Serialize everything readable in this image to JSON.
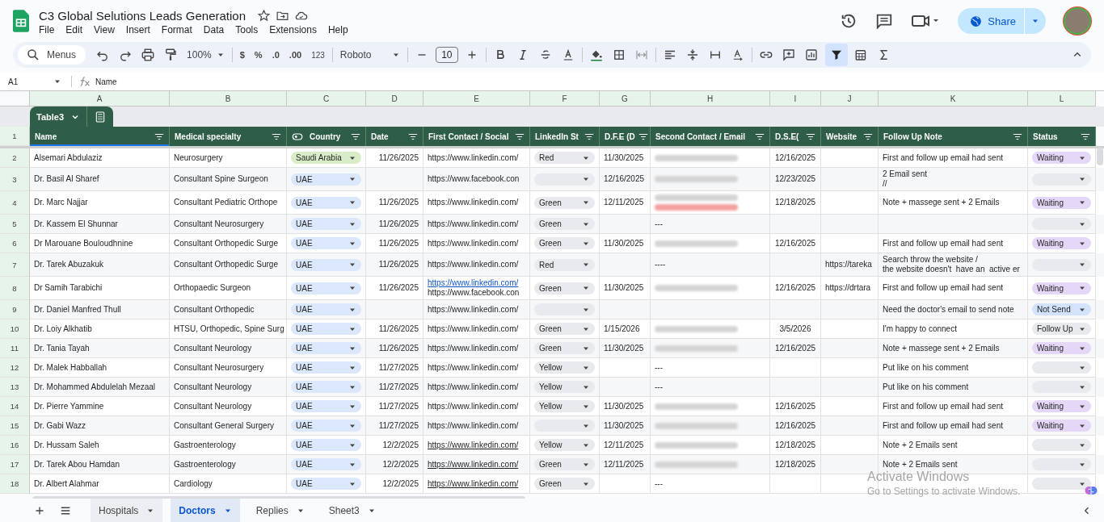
{
  "doc": {
    "title": "C3 Global Selutions Leads Generation"
  },
  "menu": [
    "File",
    "Edit",
    "View",
    "Insert",
    "Format",
    "Data",
    "Tools",
    "Extensions",
    "Help"
  ],
  "share": {
    "label": "Share"
  },
  "toolbar": {
    "search": "Menus",
    "zoom": "100%",
    "currency": "$",
    "percent": "%",
    "dec_less": ".0",
    "dec_more": ".00",
    "number_format": "123",
    "font": "Roboto",
    "font_size": "10"
  },
  "formula_bar": {
    "cell": "A1",
    "value": "Name"
  },
  "column_letters": [
    "A",
    "B",
    "C",
    "D",
    "E",
    "F",
    "G",
    "H",
    "I",
    "J",
    "K",
    "L"
  ],
  "table_name": "Table3",
  "header": {
    "num": "1",
    "columns": [
      "Name",
      "Medical specialty",
      "Country",
      "Date",
      "First Contact / Social",
      "LinkedIn St",
      "D.F.E (D",
      "Second Contact / Email",
      "D.S.E(",
      "Website",
      "Follow Up Note",
      "Status"
    ]
  },
  "rows": [
    {
      "num": "2",
      "name": "Alsemari Abdulaziz",
      "specialty": "Neurosurgery",
      "country": {
        "text": "Saudi Arabia",
        "color": "#d9ecc8"
      },
      "date": "11/26/2025",
      "first_contact": [
        {
          "text": "https://www.linkedin.com/",
          "kind": "plain"
        }
      ],
      "linkedin": {
        "text": "Red"
      },
      "dfe": "11/30/2025",
      "second_contact": [
        {
          "kind": "blurred"
        }
      ],
      "dse": "12/16/2025",
      "note": [
        "First and follow up email had sent"
      ],
      "status": {
        "text": "Waiting",
        "color": "#e4d7f7"
      }
    },
    {
      "num": "3",
      "name": "Dr. Basil Al Sharef",
      "specialty": "Consultant Spine Surgeon",
      "country": {
        "text": "UAE",
        "color": "#dbe7fb"
      },
      "first_contact": [
        {
          "text": "https://www.facebook.con",
          "kind": "plain"
        }
      ],
      "linkedin": {},
      "dfe": "12/16/2025",
      "second_contact": [
        {
          "kind": "blurred"
        }
      ],
      "dse": "12/23/2025",
      "note": [
        "2 Email sent",
        "//"
      ],
      "status": {
        "color": "#e8eaed"
      }
    },
    {
      "num": "4",
      "name": "Dr. Marc Najjar",
      "specialty": "Consultant Pediatric Orthope",
      "country": {
        "text": "UAE",
        "color": "#dbe7fb"
      },
      "date": "11/26/2025",
      "first_contact": [
        {
          "text": "https://www.linkedin.com/",
          "kind": "plain"
        }
      ],
      "linkedin": {
        "text": "Green"
      },
      "dfe": "12/11/2025",
      "second_contact": [
        {
          "kind": "blurred"
        },
        {
          "kind": "blurred_error"
        }
      ],
      "dse": "12/18/2025",
      "note": [
        "Note + massege sent + 2 Emails"
      ],
      "status": {
        "text": "Waiting",
        "color": "#e4d7f7"
      }
    },
    {
      "num": "5",
      "name": "Dr. Kassem El Shunnar",
      "specialty": "Consultant Neurosurgery",
      "country": {
        "text": "UAE",
        "color": "#dbe7fb"
      },
      "date": "11/26/2025",
      "first_contact": [
        {
          "text": "https://www.linkedin.com/",
          "kind": "plain"
        }
      ],
      "linkedin": {
        "text": "Green"
      },
      "second_contact": [
        {
          "kind": "text",
          "text": "---"
        }
      ],
      "status": {
        "color": "#e8eaed"
      }
    },
    {
      "num": "6",
      "name": "Dr Marouane Bouloudhnine",
      "specialty": "Consultant Orthopedic Surge",
      "country": {
        "text": "UAE",
        "color": "#dbe7fb"
      },
      "date": "11/26/2025",
      "first_contact": [
        {
          "text": "https://www.linkedin.com/",
          "kind": "plain"
        }
      ],
      "linkedin": {
        "text": "Green"
      },
      "dfe": "11/30/2025",
      "second_contact": [
        {
          "kind": "blurred"
        }
      ],
      "dse": "12/16/2025",
      "note": [
        "First and follow up email had sent"
      ],
      "status": {
        "text": "Waiting",
        "color": "#e4d7f7"
      }
    },
    {
      "num": "7",
      "name": "Dr. Tarek Abuzakuk",
      "specialty": "Consultant Orthopedic Surge",
      "country": {
        "text": "UAE",
        "color": "#dbe7fb"
      },
      "date": "11/26/2025",
      "first_contact": [
        {
          "text": "https://www.linkedin.com/",
          "kind": "plain"
        }
      ],
      "linkedin": {
        "text": "Red"
      },
      "second_contact": [
        {
          "kind": "text",
          "text": "----"
        }
      ],
      "website": "https://tareka",
      "note": [
        "Search throw the website /",
        "the website doesn't  have an  active er"
      ],
      "status": {
        "color": "#e8eaed"
      }
    },
    {
      "num": "8",
      "name": "Dr Samih Tarabichi",
      "specialty": "Orthopaedic Surgeon",
      "country": {
        "text": "UAE",
        "color": "#dbe7fb"
      },
      "date": "11/26/2025",
      "first_contact": [
        {
          "text": "https://www.linkedin.com/",
          "kind": "link"
        },
        {
          "text": "https://www.facebook.con",
          "kind": "plain"
        }
      ],
      "linkedin": {
        "text": "Green"
      },
      "dfe": "11/30/2025",
      "second_contact": [
        {
          "kind": "blurred"
        }
      ],
      "dse": "12/16/2025",
      "website": "https://drtara",
      "note": [
        "First and follow up email had sent"
      ],
      "status": {
        "text": "Waiting",
        "color": "#e4d7f7"
      }
    },
    {
      "num": "9",
      "name": "Dr. Daniel Manfred Thull",
      "specialty": "Consultant Orthopedic",
      "country": {
        "text": "UAE",
        "color": "#dbe7fb"
      },
      "first_contact": [
        {
          "text": "https://www.linkedin.com/",
          "kind": "plain"
        }
      ],
      "linkedin": {},
      "note": [
        "Need the doctor's email to send note"
      ],
      "status": {
        "text": "Not Send",
        "color": "#d3e3fd"
      }
    },
    {
      "num": "10",
      "name": "Dr. Loiy Alkhatib",
      "specialty": "HTSU, Orthopedic, Spine Surg",
      "country": {
        "text": "UAE",
        "color": "#dbe7fb"
      },
      "date": "11/26/2025",
      "first_contact": [
        {
          "text": "https://www.linkedin.com/",
          "kind": "plain"
        }
      ],
      "linkedin": {
        "text": "Green"
      },
      "dfe": "1/15/2026",
      "second_contact": [
        {
          "kind": "blurred"
        }
      ],
      "dse": "3/5/2026",
      "note": [
        "I'm happy to connect"
      ],
      "status": {
        "text": "Follow Up",
        "color": "#e8eaed"
      }
    },
    {
      "num": "11",
      "name": "Dr. Tania Tayah",
      "specialty": "Consultant Neurology",
      "country": {
        "text": "UAE",
        "color": "#dbe7fb"
      },
      "date": "11/26/2025",
      "first_contact": [
        {
          "text": "https://www.linkedin.com/",
          "kind": "plain"
        }
      ],
      "linkedin": {
        "text": "Green"
      },
      "dfe": "11/30/2025",
      "second_contact": [
        {
          "kind": "blurred"
        }
      ],
      "dse": "12/16/2025",
      "note": [
        "Note + massege sent + 2 Emails"
      ],
      "status": {
        "text": "Waiting",
        "color": "#e4d7f7"
      }
    },
    {
      "num": "12",
      "name": "Dr. Malek Habballah",
      "specialty": "Consultant Neurosurgery",
      "country": {
        "text": "UAE",
        "color": "#dbe7fb"
      },
      "date": "11/27/2025",
      "first_contact": [
        {
          "text": "https://www.linkedin.com/",
          "kind": "plain"
        }
      ],
      "linkedin": {
        "text": "Yellow"
      },
      "second_contact": [
        {
          "kind": "text",
          "text": "---"
        }
      ],
      "note": [
        "Put like on his comment"
      ],
      "status": {
        "color": "#e8eaed"
      }
    },
    {
      "num": "13",
      "name": "Dr. Mohammed Abdulelah Mezaal",
      "specialty": "Consultant Neurology",
      "country": {
        "text": "UAE",
        "color": "#dbe7fb"
      },
      "date": "11/27/2025",
      "first_contact": [
        {
          "text": "https://www.linkedin.com/",
          "kind": "plain"
        }
      ],
      "linkedin": {
        "text": "Yellow"
      },
      "second_contact": [
        {
          "kind": "text",
          "text": "---"
        }
      ],
      "note": [
        "Put like on his comment"
      ],
      "status": {
        "color": "#e8eaed"
      }
    },
    {
      "num": "14",
      "name": "Dr. Pierre Yammine",
      "specialty": "Consultant Neurology",
      "country": {
        "text": "UAE",
        "color": "#dbe7fb"
      },
      "date": "11/27/2025",
      "first_contact": [
        {
          "text": "https://www.linkedin.com/",
          "kind": "plain"
        }
      ],
      "linkedin": {
        "text": "Yellow"
      },
      "dfe": "11/30/2025",
      "second_contact": [
        {
          "kind": "blurred"
        }
      ],
      "dse": "12/16/2025",
      "note": [
        "First and follow up email had sent"
      ],
      "status": {
        "text": "Waiting",
        "color": "#e4d7f7"
      }
    },
    {
      "num": "15",
      "name": "Dr. Gabi Wazz",
      "specialty": "Consultant General Surgery",
      "country": {
        "text": "UAE",
        "color": "#dbe7fb"
      },
      "date": "11/27/2025",
      "first_contact": [
        {
          "text": "https://www.linkedin.com/",
          "kind": "plain"
        }
      ],
      "linkedin": {},
      "dfe": "11/30/2025",
      "second_contact": [
        {
          "kind": "blurred"
        }
      ],
      "dse": "12/16/2025",
      "note": [
        "First and follow up email had sent"
      ],
      "status": {
        "text": "Waiting",
        "color": "#e4d7f7"
      }
    },
    {
      "num": "16",
      "name": "Dr. Hussam Saleh",
      "specialty": "Gastroenterology",
      "country": {
        "text": "UAE",
        "color": "#dbe7fb"
      },
      "date": "12/2/2025",
      "first_contact": [
        {
          "text": "https://www.linkedin.com/",
          "kind": "link_dark"
        }
      ],
      "linkedin": {
        "text": "Yellow"
      },
      "dfe": "12/11/2025",
      "second_contact": [
        {
          "kind": "blurred"
        }
      ],
      "dse": "12/18/2025",
      "note": [
        "Note + 2 Emails sent"
      ],
      "status": {
        "color": "#e8eaed"
      }
    },
    {
      "num": "17",
      "name": "Dr. Tarek Abou Hamdan",
      "specialty": "Gastroenterology",
      "country": {
        "text": "UAE",
        "color": "#dbe7fb"
      },
      "date": "12/2/2025",
      "first_contact": [
        {
          "text": "https://www.linkedin.com/",
          "kind": "link_dark"
        }
      ],
      "linkedin": {
        "text": "Green"
      },
      "dfe": "12/11/2025",
      "second_contact": [
        {
          "kind": "blurred"
        }
      ],
      "dse": "12/18/2025",
      "note": [
        "Note + 2 Emails sent"
      ],
      "status": {
        "color": "#e8eaed"
      }
    },
    {
      "num": "18",
      "name": "Dr. Albert Alahmar",
      "specialty": "Cardiology",
      "country": {
        "text": "UAE",
        "color": "#dbe7fb"
      },
      "date": "12/2/2025",
      "first_contact": [
        {
          "text": "https://www.linkedin.com/",
          "kind": "link_dark"
        }
      ],
      "linkedin": {
        "text": "Green"
      },
      "second_contact": [
        {
          "kind": "text",
          "text": "---"
        }
      ],
      "status": {
        "color": "#e8eaed"
      }
    }
  ],
  "sheet_tabs": [
    {
      "label": "Hospitals",
      "selected": false
    },
    {
      "label": "Doctors",
      "selected": true
    },
    {
      "label": "Replies",
      "selected": false
    },
    {
      "label": "Sheet3",
      "selected": false
    }
  ],
  "os_overlay": {
    "title": "Activate Windows",
    "subtitle": "Go to Settings to activate Windows."
  }
}
